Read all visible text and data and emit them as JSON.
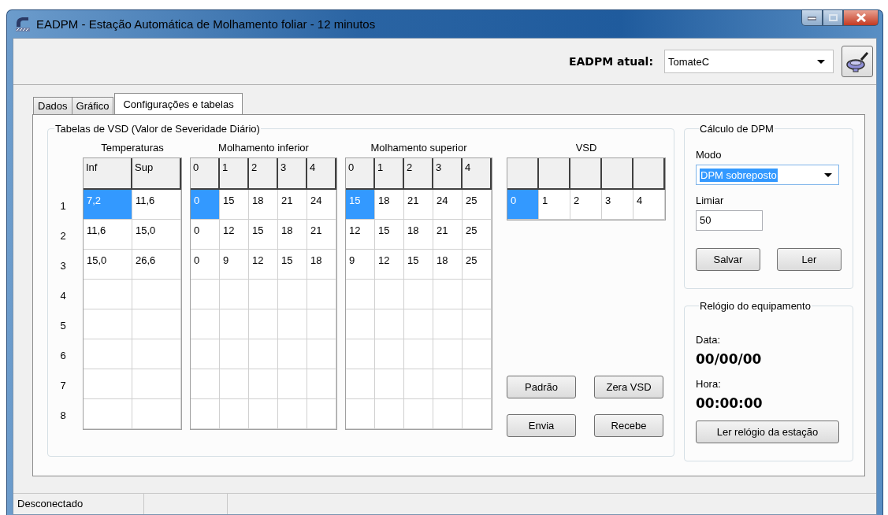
{
  "window": {
    "title": "EADPM - Estação Automática de Molhamento foliar - 12 minutos"
  },
  "toolbar": {
    "label": "EADPM atual:",
    "station": {
      "value": "TomateC"
    }
  },
  "tabs": [
    {
      "label": "Dados",
      "selected": false
    },
    {
      "label": "Gráfico",
      "selected": false
    },
    {
      "label": "Configurações e tabelas",
      "selected": true
    }
  ],
  "vsd_group": {
    "title": "Tabelas de VSD (Valor de Severidade Diário)",
    "row_labels": [
      "1",
      "2",
      "3",
      "4",
      "5",
      "6",
      "7",
      "8"
    ],
    "tables": [
      {
        "kind": "numbered",
        "title": "Temperaturas",
        "columns": [
          "Inf",
          "Sup"
        ],
        "rows": [
          [
            {
              "text": "7,2",
              "selected": true
            },
            {
              "text": "11,6",
              "selected": false
            }
          ],
          [
            {
              "text": "11,6",
              "selected": false
            },
            {
              "text": "15,0",
              "selected": false
            }
          ],
          [
            {
              "text": "15,0",
              "selected": false
            },
            {
              "text": "26,6",
              "selected": false
            }
          ]
        ]
      },
      {
        "kind": "numbered",
        "title": "Molhamento inferior",
        "columns": [
          "0",
          "1",
          "2",
          "3",
          "4"
        ],
        "rows": [
          [
            {
              "text": "0",
              "selected": true
            },
            {
              "text": "15",
              "selected": false
            },
            {
              "text": "18",
              "selected": false
            },
            {
              "text": "21",
              "selected": false
            },
            {
              "text": "24",
              "selected": false
            }
          ],
          [
            {
              "text": "0",
              "selected": false
            },
            {
              "text": "12",
              "selected": false
            },
            {
              "text": "15",
              "selected": false
            },
            {
              "text": "18",
              "selected": false
            },
            {
              "text": "21",
              "selected": false
            }
          ],
          [
            {
              "text": "0",
              "selected": false
            },
            {
              "text": "9",
              "selected": false
            },
            {
              "text": "12",
              "selected": false
            },
            {
              "text": "15",
              "selected": false
            },
            {
              "text": "18",
              "selected": false
            }
          ]
        ]
      },
      {
        "kind": "numbered",
        "title": "Molhamento superior",
        "columns": [
          "0",
          "1",
          "2",
          "3",
          "4"
        ],
        "rows": [
          [
            {
              "text": "15",
              "selected": true
            },
            {
              "text": "18",
              "selected": false
            },
            {
              "text": "21",
              "selected": false
            },
            {
              "text": "24",
              "selected": false
            },
            {
              "text": "25",
              "selected": false
            }
          ],
          [
            {
              "text": "12",
              "selected": false
            },
            {
              "text": "15",
              "selected": false
            },
            {
              "text": "18",
              "selected": false
            },
            {
              "text": "21",
              "selected": false
            },
            {
              "text": "25",
              "selected": false
            }
          ],
          [
            {
              "text": "9",
              "selected": false
            },
            {
              "text": "12",
              "selected": false
            },
            {
              "text": "15",
              "selected": false
            },
            {
              "text": "18",
              "selected": false
            },
            {
              "text": "25",
              "selected": false
            }
          ]
        ]
      },
      {
        "kind": "single",
        "title": "VSD",
        "rows": [
          [
            {
              "text": "0",
              "selected": true
            },
            {
              "text": "1",
              "selected": false
            },
            {
              "text": "2",
              "selected": false
            },
            {
              "text": "3",
              "selected": false
            },
            {
              "text": "4",
              "selected": false
            }
          ]
        ]
      }
    ],
    "buttons": [
      "Padrão",
      "Zera VSD",
      "Envia",
      "Recebe"
    ]
  },
  "dpm_group": {
    "title": "Cálculo de DPM",
    "mode_label": "Modo",
    "mode": {
      "value": "DPM sobreposto",
      "highlighted": true
    },
    "threshold_label": "Limiar",
    "threshold": {
      "value": "50"
    },
    "buttons": [
      "Salvar",
      "Ler"
    ]
  },
  "clock_group": {
    "title": "Relógio do equipamento",
    "date_label": "Data:",
    "date": "00/00/00",
    "time_label": "Hora:",
    "time": "00:00:00",
    "button": "Ler relógio da estação"
  },
  "status_bar": {
    "text": "Desconectado"
  }
}
